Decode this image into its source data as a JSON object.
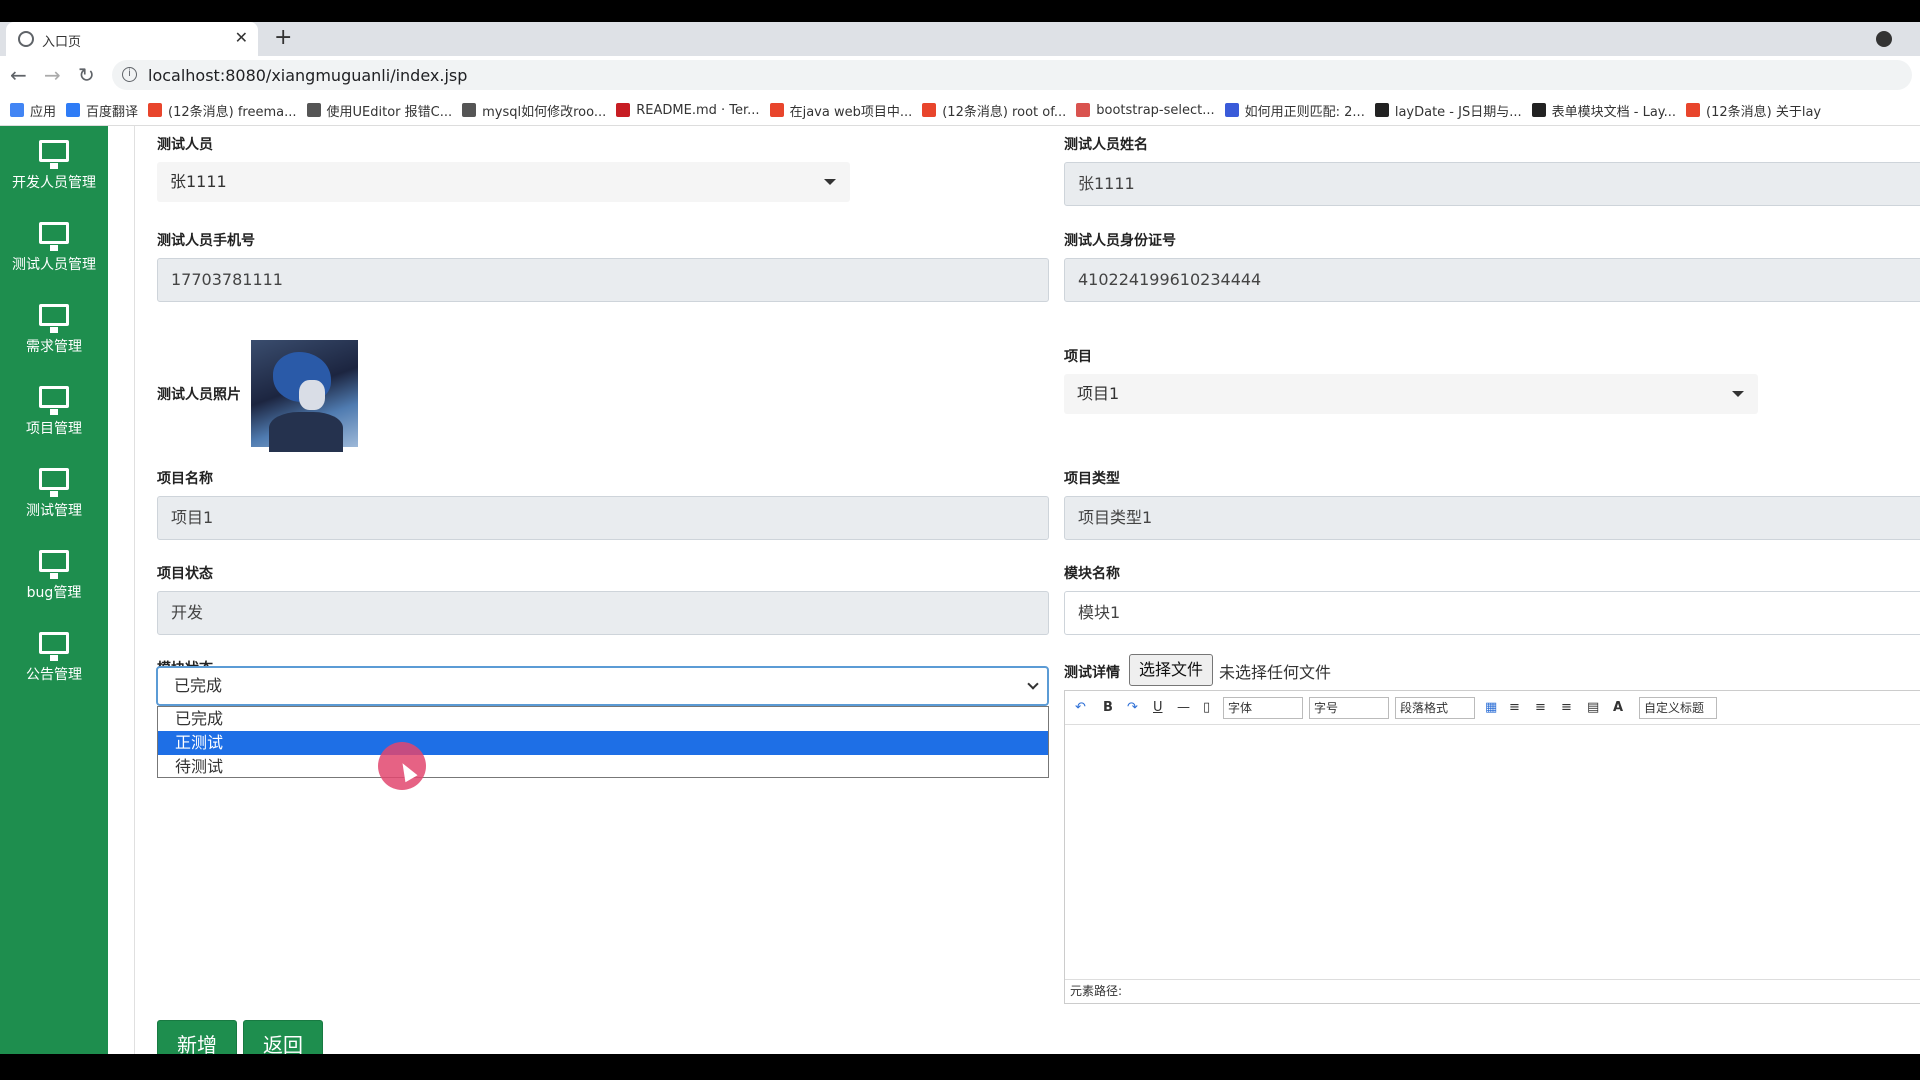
{
  "browser": {
    "tab_title": "入口页",
    "url": "localhost:8080/xiangmuguanli/index.jsp",
    "bookmarks": [
      {
        "label": "应用",
        "color": "#4285f4"
      },
      {
        "label": "百度翻译",
        "color": "#2f7cf6"
      },
      {
        "label": "(12条消息) freema...",
        "color": "#e8452c"
      },
      {
        "label": "使用UEditor 报错C...",
        "color": "#555555"
      },
      {
        "label": "mysql如何修改roo...",
        "color": "#555555"
      },
      {
        "label": "README.md · Ter...",
        "color": "#c71d23"
      },
      {
        "label": "在java web项目中...",
        "color": "#e8452c"
      },
      {
        "label": "(12条消息) root of...",
        "color": "#e8452c"
      },
      {
        "label": "bootstrap-select...",
        "color": "#d9534f"
      },
      {
        "label": "如何用正则匹配: 2...",
        "color": "#3a5bd9"
      },
      {
        "label": "layDate - JS日期与...",
        "color": "#222222"
      },
      {
        "label": "表单模块文档 - Lay...",
        "color": "#222222"
      },
      {
        "label": "(12条消息) 关于lay",
        "color": "#e8452c"
      }
    ]
  },
  "sidebar": {
    "items": [
      {
        "label": "开发人员管理",
        "icon": "monitor-icon"
      },
      {
        "label": "测试人员管理",
        "icon": "monitor-icon"
      },
      {
        "label": "需求管理",
        "icon": "monitor-icon"
      },
      {
        "label": "项目管理",
        "icon": "monitor-icon"
      },
      {
        "label": "测试管理",
        "icon": "monitor-icon"
      },
      {
        "label": "bug管理",
        "icon": "monitor-icon"
      },
      {
        "label": "公告管理",
        "icon": "monitor-icon"
      }
    ],
    "color": "#1e8e4e"
  },
  "form": {
    "tester_label": "测试人员",
    "tester_value": "张1111",
    "tester_name_label": "测试人员姓名",
    "tester_name_value": "张1111",
    "tester_phone_label": "测试人员手机号",
    "tester_phone_value": "17703781111",
    "tester_id_label": "测试人员身份证号",
    "tester_id_value": "410224199610234444",
    "tester_photo_label": "测试人员照片",
    "project_label": "项目",
    "project_value": "项目1",
    "project_name_label": "项目名称",
    "project_name_value": "项目1",
    "project_type_label": "项目类型",
    "project_type_value": "项目类型1",
    "project_status_label": "项目状态",
    "project_status_value": "开发",
    "module_name_label": "模块名称",
    "module_name_value": "模块1",
    "module_status_label": "模块状态",
    "module_status_value": "已完成",
    "module_status_options": [
      "已完成",
      "正测试",
      "待测试"
    ],
    "module_status_highlighted": "正测试",
    "test_detail_label": "测试详情",
    "file_button": "选择文件",
    "file_none": "未选择任何文件"
  },
  "editor": {
    "font_combo": "字体",
    "size_combo": "字号",
    "para_combo": "段落格式",
    "custom_combo": "自定义标题",
    "status_path": "元素路径:"
  },
  "actions": {
    "add": "新增",
    "back": "返回"
  }
}
